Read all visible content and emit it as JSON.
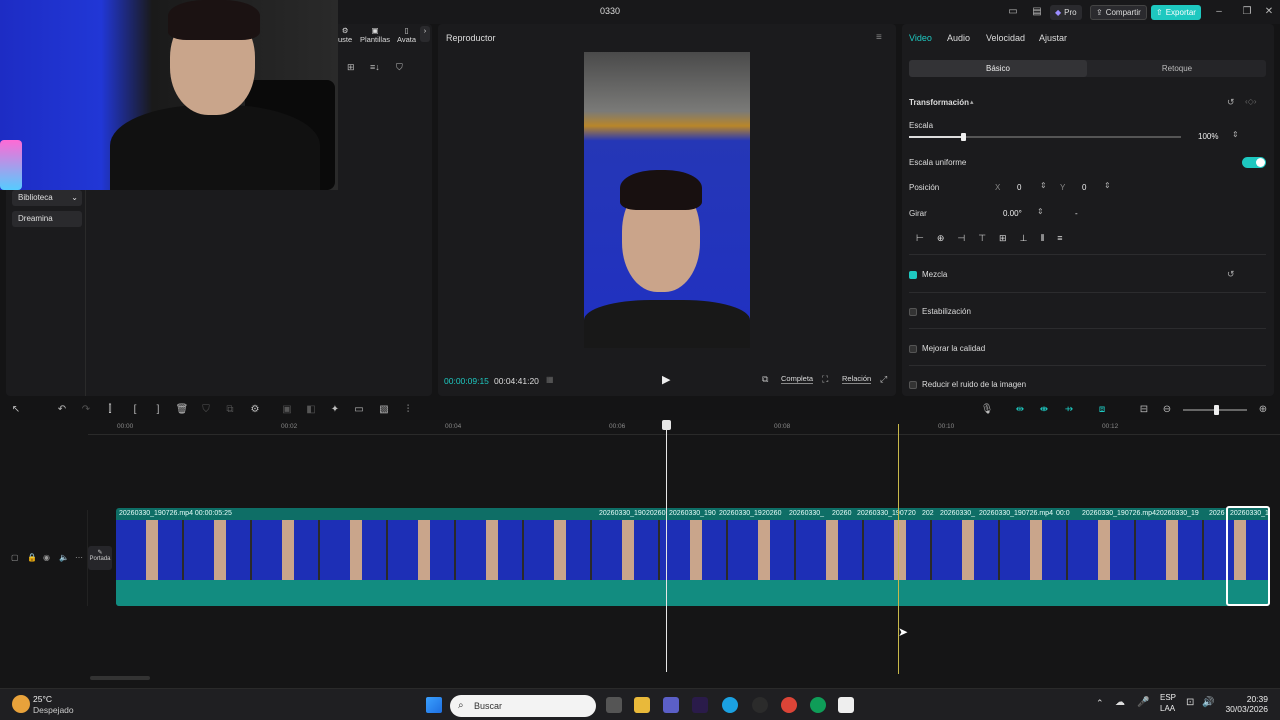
{
  "window": {
    "title": "0330"
  },
  "titlebar": {
    "pro": "Pro",
    "share": "Compartir",
    "export": "Exportar"
  },
  "left": {
    "top_icons": [
      "uste",
      "Plantillas",
      "Avata"
    ],
    "nav": [
      "Biblioteca",
      "Dreamina"
    ]
  },
  "player": {
    "title": "Reproductor",
    "current_time": "00:00:09:15",
    "total_time": "00:04:41:20",
    "full_label": "Completa",
    "ratio_label": "Relación"
  },
  "right": {
    "tabs": [
      "Video",
      "Audio",
      "Velocidad",
      "Ajustar"
    ],
    "subtabs": [
      "Básico",
      "Retoque"
    ],
    "transform_title": "Transformación",
    "scale_label": "Escala",
    "scale_value": "100%",
    "scale_fraction": 0.2,
    "uniform_label": "Escala uniforme",
    "position_label": "Posición",
    "pos_x_label": "X",
    "pos_x": "0",
    "pos_y_label": "Y",
    "pos_y": "0",
    "rotate_label": "Girar",
    "rotate_value": "0.00°",
    "rotate_extra": "-",
    "blend": "Mezcla",
    "stabilize": "Estabilización",
    "enhance": "Mejorar la calidad",
    "denoise": "Reducir el ruido de la imagen"
  },
  "timeline": {
    "ruler": [
      "00:00",
      "00:02",
      "00:04",
      "00:06",
      "00:08",
      "00:10",
      "00:12"
    ],
    "cover_label": "Portada",
    "clips": [
      {
        "label": "20260330_190726.mp4   00:00:05:25"
      },
      {
        "label": "20260330_190"
      },
      {
        "label": "20260"
      },
      {
        "label": "20260330_190"
      },
      {
        "label": "20260330_19"
      },
      {
        "label": "20260"
      },
      {
        "label": "20260330_"
      },
      {
        "label": "20260"
      },
      {
        "label": "20260330_1907"
      },
      {
        "label": "20"
      },
      {
        "label": "202"
      },
      {
        "label": "20260330_"
      },
      {
        "label": "20260330_190726.mp4"
      },
      {
        "label": "00:0"
      },
      {
        "label": "20260330_190726.mp4"
      },
      {
        "label": "20260330_19"
      },
      {
        "label": "2026"
      },
      {
        "label": "20260330_1"
      }
    ]
  },
  "taskbar": {
    "weather_temp": "25°C",
    "weather_desc": "Despejado",
    "search": "Buscar",
    "lang": "ESP",
    "lang2": "LAA",
    "time": "20:39",
    "date": "30/03/2026"
  }
}
